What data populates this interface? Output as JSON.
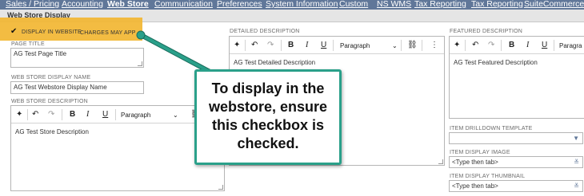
{
  "tabs": [
    {
      "label": "Sales / Pricing",
      "active": false
    },
    {
      "label": "Accounting",
      "active": false
    },
    {
      "label": "Web Store",
      "active": true
    },
    {
      "label": "Communication",
      "active": false
    },
    {
      "label": "Preferences",
      "active": false
    },
    {
      "label": "System Information",
      "active": false
    },
    {
      "label": "Custom",
      "active": false
    },
    {
      "label": "NS WMS",
      "active": false
    },
    {
      "label": "Tax Reporting",
      "active": false
    },
    {
      "label": "Tax Reporting",
      "active": false
    },
    {
      "label": "SuiteCommerce Pr",
      "active": false
    }
  ],
  "section": {
    "title": "Web Store Display"
  },
  "display_checkbox": {
    "checked": true,
    "label": "DISPLAY IN WEBSITE",
    "hint": "CHARGES MAY APP"
  },
  "page_title": {
    "label": "PAGE TITLE",
    "value": "AG Test Page Title"
  },
  "display_name": {
    "label": "WEB STORE DISPLAY NAME",
    "value": "AG Test Webstore Display Name"
  },
  "store_description": {
    "label": "WEB STORE DESCRIPTION",
    "paragraph": "Paragraph",
    "value": "AG Test Store Description"
  },
  "detailed_description": {
    "label": "DETAILED DESCRIPTION",
    "paragraph": "Paragraph",
    "value": "AG Test Detailed Description"
  },
  "featured_description": {
    "label": "FEATURED DESCRIPTION",
    "paragraph": "Paragra",
    "value": "AG Test Featured Description"
  },
  "drilldown_template": {
    "label": "ITEM DRILLDOWN TEMPLATE",
    "value": ""
  },
  "display_image": {
    "label": "ITEM DISPLAY IMAGE",
    "value": "<Type then tab>"
  },
  "display_thumbnail": {
    "label": "ITEM DISPLAY THUMBNAIL",
    "value": "<Type then tab>"
  },
  "toolbar": {
    "bold": "B",
    "italic": "I",
    "underline": "U",
    "undo": "↶",
    "redo": "↷",
    "ai": "✦",
    "link": "⛓",
    "more": "⋮",
    "chevron": "⌄"
  },
  "callout": {
    "text": "To display in the webstore, ensure this checkbox is checked."
  },
  "colors": {
    "tabbar": "#607799",
    "highlight": "#f2b632",
    "callout_border": "#2aa08a",
    "arrow": "#2aa08a"
  }
}
